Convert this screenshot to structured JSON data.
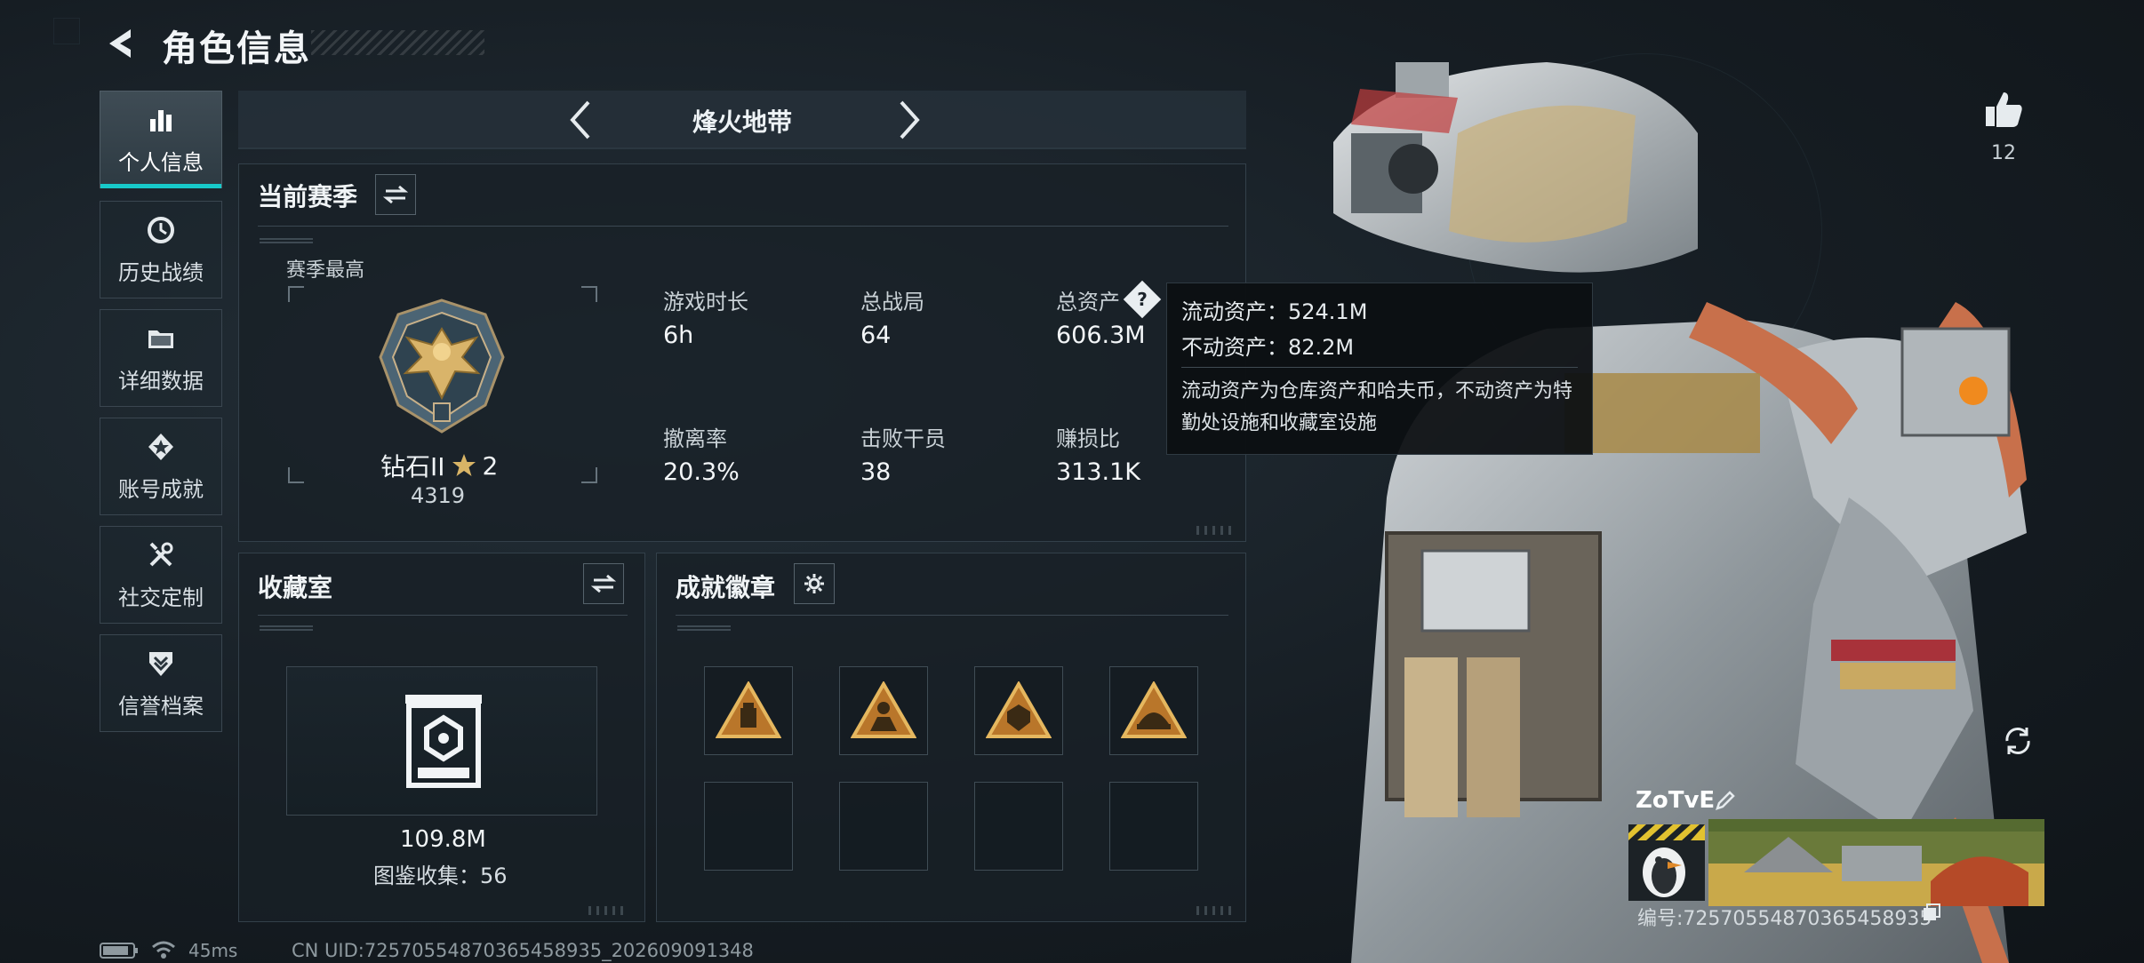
{
  "header": {
    "title": "角色信息"
  },
  "sidebar": {
    "items": [
      {
        "label": "个人信息",
        "icon": "bar-chart-icon",
        "active": true
      },
      {
        "label": "历史战绩",
        "icon": "history-clock-icon",
        "active": false
      },
      {
        "label": "详细数据",
        "icon": "folder-icon",
        "active": false
      },
      {
        "label": "账号成就",
        "icon": "achievement-star-icon",
        "active": false
      },
      {
        "label": "社交定制",
        "icon": "tools-icon",
        "active": false
      },
      {
        "label": "信誉档案",
        "icon": "shield-chevron-icon",
        "active": false
      }
    ]
  },
  "mode_nav": {
    "title": "烽火地带"
  },
  "season": {
    "title": "当前赛季",
    "best_label": "赛季最高",
    "rank_name": "钻石II",
    "rank_stars": "2",
    "rank_score": "4319",
    "stats": [
      {
        "label": "游戏时长",
        "value": "6h"
      },
      {
        "label": "总战局",
        "value": "64"
      },
      {
        "label": "总资产",
        "value": "606.3M"
      },
      {
        "label": "撤离率",
        "value": "20.3%"
      },
      {
        "label": "击败干员",
        "value": "38"
      },
      {
        "label": "赚损比",
        "value": "313.1K"
      }
    ]
  },
  "tooltip": {
    "liquid": "流动资产：524.1M",
    "fixed": "不动资产：82.2M",
    "description": "流动资产为仓库资产和哈夫币，不动资产为特勤处设施和收藏室设施"
  },
  "collection": {
    "title": "收藏室",
    "value": "109.8M",
    "count_text": "图鉴收集：56"
  },
  "badges": {
    "title": "成就徽章",
    "filled": [
      "badge-supply-icon",
      "badge-operator-icon",
      "badge-armor-icon",
      "badge-vehicle-icon"
    ],
    "empty_count": 4
  },
  "profile": {
    "likes": "12",
    "name": "ZoTvE",
    "id_text": "编号:7257055487036545​8935"
  },
  "status_bar": {
    "ping": "45ms",
    "uid": "CN UID:7257055487036545​8935_202609091348"
  },
  "colors": {
    "accent_cyan": "#17c9c9",
    "panel_bg": "#182027",
    "gold": "#c99a3a"
  }
}
